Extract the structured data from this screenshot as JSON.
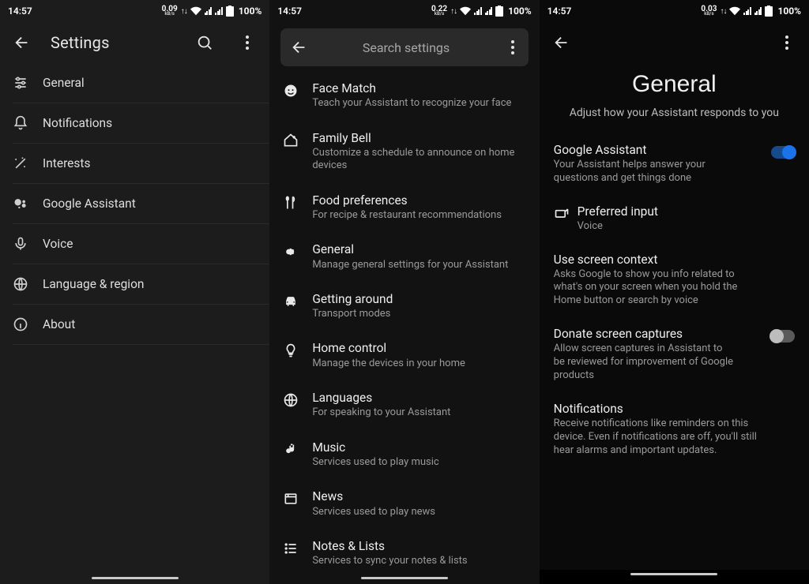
{
  "status": {
    "time": "14:57",
    "battery": "100%"
  },
  "p1": {
    "title": "Settings",
    "rate": "0.09",
    "rate_unit": "kB/s",
    "items": [
      {
        "label": "General"
      },
      {
        "label": "Notifications"
      },
      {
        "label": "Interests"
      },
      {
        "label": "Google Assistant"
      },
      {
        "label": "Voice"
      },
      {
        "label": "Language & region"
      },
      {
        "label": "About"
      }
    ]
  },
  "p2": {
    "search_placeholder": "Search settings",
    "rate": "0.22",
    "rate_unit": "kB/s",
    "items": [
      {
        "title": "Face Match",
        "sub": "Teach your Assistant to recognize your face"
      },
      {
        "title": "Family Bell",
        "sub": "Customize a schedule to announce on home devices"
      },
      {
        "title": "Food preferences",
        "sub": "For recipe & restaurant recommendations"
      },
      {
        "title": "General",
        "sub": "Manage general settings for your Assistant"
      },
      {
        "title": "Getting around",
        "sub": "Transport modes"
      },
      {
        "title": "Home control",
        "sub": "Manage the devices in your home"
      },
      {
        "title": "Languages",
        "sub": "For speaking to your Assistant"
      },
      {
        "title": "Music",
        "sub": "Services used to play music"
      },
      {
        "title": "News",
        "sub": "Services used to play news"
      },
      {
        "title": "Notes & Lists",
        "sub": "Services to sync your notes & lists"
      }
    ]
  },
  "p3": {
    "rate": "0.03",
    "rate_unit": "kB/s",
    "heading": "General",
    "subheading": "Adjust how your Assistant responds to you",
    "rows": {
      "assistant": {
        "title": "Google Assistant",
        "sub": "Your Assistant helps answer your questions and get things done"
      },
      "preferred": {
        "title": "Preferred input",
        "sub": "Voice"
      },
      "context": {
        "title": "Use screen context",
        "sub": "Asks Google to show you info related to what's on your screen when you hold the Home button or search by voice"
      },
      "donate": {
        "title": "Donate screen captures",
        "sub": "Allow screen captures in Assistant to be reviewed for improvement of Google products"
      },
      "notif": {
        "title": "Notifications",
        "sub": "Receive notifications like reminders on this device. Even if notifications are off, you'll still hear alarms and important updates."
      }
    }
  }
}
